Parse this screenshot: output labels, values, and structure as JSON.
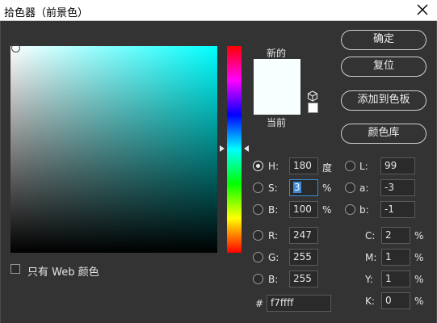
{
  "window": {
    "title": "拾色器（前景色）"
  },
  "picker": {
    "new_label": "新的",
    "current_label": "当前",
    "color_hex": "#f7ffff",
    "hue_color": "#00ffff",
    "web_only_label": "只有 Web 颜色"
  },
  "buttons": {
    "ok": "确定",
    "reset": "复位",
    "add_swatch": "添加到色板",
    "libraries": "颜色库"
  },
  "hsb": [
    {
      "key": "H:",
      "value": "180",
      "unit": "度",
      "selected": true
    },
    {
      "key": "S:",
      "value": "3",
      "unit": "%",
      "selected": false
    },
    {
      "key": "B:",
      "value": "100",
      "unit": "%",
      "selected": false
    }
  ],
  "rgb": [
    {
      "key": "R:",
      "value": "247"
    },
    {
      "key": "G:",
      "value": "255"
    },
    {
      "key": "B:",
      "value": "255"
    }
  ],
  "lab": [
    {
      "key": "L:",
      "value": "99"
    },
    {
      "key": "a:",
      "value": "-3"
    },
    {
      "key": "b:",
      "value": "-1"
    }
  ],
  "cmyk": [
    {
      "key": "C:",
      "value": "2",
      "unit": "%"
    },
    {
      "key": "M:",
      "value": "1",
      "unit": "%"
    },
    {
      "key": "Y:",
      "value": "1",
      "unit": "%"
    },
    {
      "key": "K:",
      "value": "0",
      "unit": "%"
    }
  ],
  "hex": {
    "key": "#",
    "value": "f7ffff"
  },
  "icons": {
    "close": "close-icon",
    "cube": "cube-icon"
  }
}
